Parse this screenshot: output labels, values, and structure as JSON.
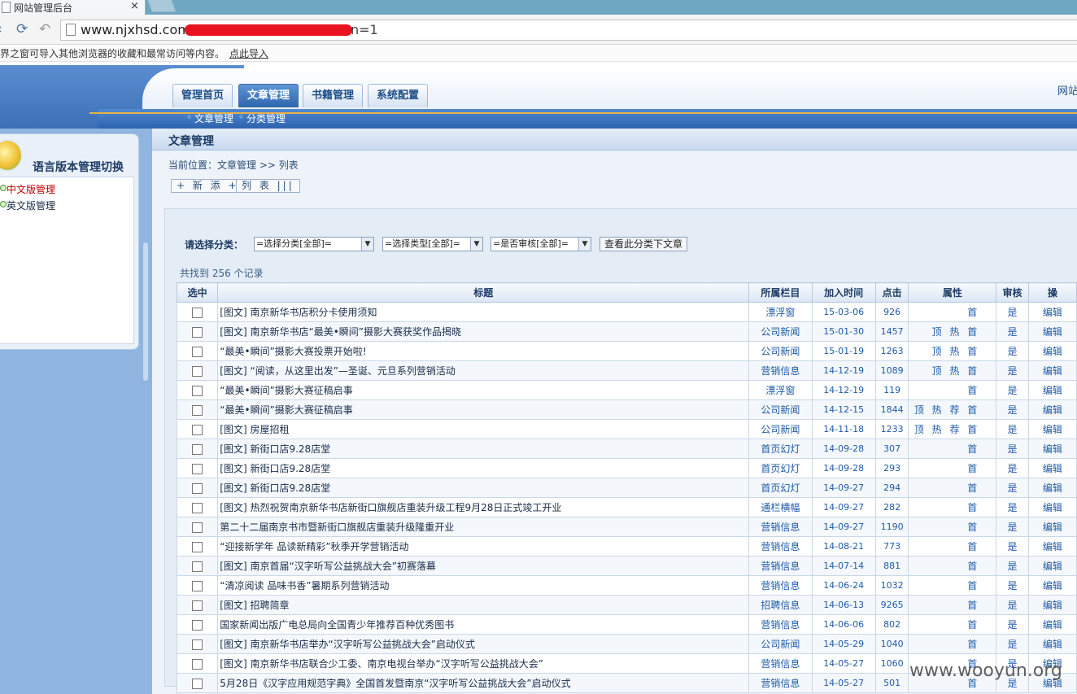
{
  "browser": {
    "tab_title": "网站管理后台",
    "tab_close": "×",
    "url_prefix": "www.njxhsd.com",
    "url_suffix": "n=1",
    "import_text": "界之窗可导入其他浏览器的收藏和最常访问等内容。",
    "import_link": "点此导入"
  },
  "header": {
    "tabs": [
      {
        "label": "管理首页",
        "active": false
      },
      {
        "label": "文章管理",
        "active": true
      },
      {
        "label": "书籍管理",
        "active": false
      },
      {
        "label": "系统配置",
        "active": false
      }
    ],
    "site_label": "网站",
    "subnav": [
      "文章管理",
      "分类管理"
    ],
    "subnav_bullet": "◦"
  },
  "sidebar": {
    "title": "语言版本管理切换",
    "items": [
      {
        "label": "中文版管理",
        "color": "#c00000"
      },
      {
        "label": "英文版管理",
        "color": "#1a2d4a"
      }
    ]
  },
  "main": {
    "title": "文章管理",
    "breadcrumb": "当前位置：文章管理 >> 列表",
    "btn_add": "+ 新 添 +",
    "btn_list": "列 表 |||",
    "filter": {
      "label": "请选择分类：",
      "category": "=选择分类[全部]=",
      "type": "=选择类型[全部]=",
      "audit": "=是否审核[全部]=",
      "button": "查看此分类下文章"
    },
    "record_count": "共找到 256 个记录",
    "table": {
      "headers": [
        "选中",
        "标题",
        "所属栏目",
        "加入时间",
        "点击",
        "属性",
        "审核",
        "操"
      ],
      "rows": [
        {
          "title": "[图文] 南京新华书店积分卡使用须知",
          "category": "漂浮窗",
          "date": "15-03-06",
          "hits": "926",
          "attr": "首",
          "audit": "是",
          "op": "编辑"
        },
        {
          "title": "[图文] 南京新华书店“最美•瞬间”摄影大赛获奖作品揭晓",
          "category": "公司新闻",
          "date": "15-01-30",
          "hits": "1457",
          "attr": "顶 热 首",
          "audit": "是",
          "op": "编辑"
        },
        {
          "title": "“最美•瞬间”摄影大赛投票开始啦!",
          "category": "公司新闻",
          "date": "15-01-19",
          "hits": "1263",
          "attr": "顶 热 首",
          "audit": "是",
          "op": "编辑"
        },
        {
          "title": "[图文] “阅读，从这里出发”—圣诞、元旦系列营销活动",
          "category": "营销信息",
          "date": "14-12-19",
          "hits": "1089",
          "attr": "顶 热 首",
          "audit": "是",
          "op": "编辑"
        },
        {
          "title": "“最美•瞬间”摄影大赛征稿启事",
          "category": "漂浮窗",
          "date": "14-12-19",
          "hits": "119",
          "attr": "首",
          "audit": "是",
          "op": "编辑"
        },
        {
          "title": "“最美•瞬间”摄影大赛征稿启事",
          "category": "公司新闻",
          "date": "14-12-15",
          "hits": "1844",
          "attr": "顶 热 荐 首",
          "audit": "是",
          "op": "编辑"
        },
        {
          "title": "[图文] 房屋招租",
          "category": "公司新闻",
          "date": "14-11-18",
          "hits": "1233",
          "attr": "顶 热 荐 首",
          "audit": "是",
          "op": "编辑"
        },
        {
          "title": "[图文] 新街口店9.28店堂",
          "category": "首页幻灯",
          "date": "14-09-28",
          "hits": "307",
          "attr": "首",
          "audit": "是",
          "op": "编辑"
        },
        {
          "title": "[图文] 新街口店9.28店堂",
          "category": "首页幻灯",
          "date": "14-09-28",
          "hits": "293",
          "attr": "首",
          "audit": "是",
          "op": "编辑"
        },
        {
          "title": "[图文] 新街口店9.28店堂",
          "category": "首页幻灯",
          "date": "14-09-27",
          "hits": "294",
          "attr": "首",
          "audit": "是",
          "op": "编辑"
        },
        {
          "title": "[图文] 热烈祝贺南京新华书店新街口旗舰店重装升级工程9月28日正式竣工开业",
          "category": "通栏横幅",
          "date": "14-09-27",
          "hits": "282",
          "attr": "首",
          "audit": "是",
          "op": "编辑"
        },
        {
          "title": "第二十二届南京书市暨新街口旗舰店重装升级隆重开业",
          "category": "营销信息",
          "date": "14-09-27",
          "hits": "1190",
          "attr": "首",
          "audit": "是",
          "op": "编辑"
        },
        {
          "title": "“迎接新学年 品读新精彩”秋季开学营销活动",
          "category": "营销信息",
          "date": "14-08-21",
          "hits": "773",
          "attr": "首",
          "audit": "是",
          "op": "编辑"
        },
        {
          "title": "[图文] 南京首届“汉字听写公益挑战大会”初赛落幕",
          "category": "营销信息",
          "date": "14-07-14",
          "hits": "881",
          "attr": "首",
          "audit": "是",
          "op": "编辑"
        },
        {
          "title": "“清凉阅读 品味书香”暑期系列营销活动",
          "category": "营销信息",
          "date": "14-06-24",
          "hits": "1032",
          "attr": "首",
          "audit": "是",
          "op": "编辑"
        },
        {
          "title": "[图文] 招聘简章",
          "category": "招聘信息",
          "date": "14-06-13",
          "hits": "9265",
          "attr": "首",
          "audit": "是",
          "op": "编辑"
        },
        {
          "title": "国家新闻出版广电总局向全国青少年推荐百种优秀图书",
          "category": "营销信息",
          "date": "14-06-06",
          "hits": "802",
          "attr": "首",
          "audit": "是",
          "op": "编辑"
        },
        {
          "title": "[图文] 南京新华书店举办“汉字听写公益挑战大会”启动仪式",
          "category": "公司新闻",
          "date": "14-05-29",
          "hits": "1040",
          "attr": "首",
          "audit": "是",
          "op": "编辑"
        },
        {
          "title": "[图文] 南京新华书店联合少工委、南京电视台举办“汉字听写公益挑战大会”",
          "category": "营销信息",
          "date": "14-05-27",
          "hits": "1060",
          "attr": "首",
          "audit": "是",
          "op": "编辑"
        },
        {
          "title": "5月28日《汉字应用规范字典》全国首发暨南京“汉字听写公益挑战大会”启动仪式",
          "category": "营销信息",
          "date": "14-05-27",
          "hits": "501",
          "attr": "首",
          "audit": "是",
          "op": "编辑"
        }
      ]
    }
  },
  "watermark": "www.wooyun.org"
}
